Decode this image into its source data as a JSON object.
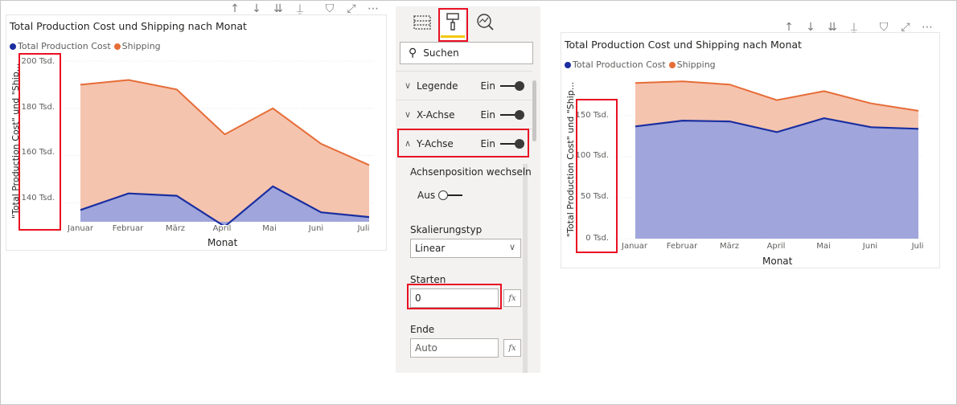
{
  "colors": {
    "blue": "#1a2ea0",
    "blue_fill": "#a0a6db",
    "orange": "#e66c37",
    "orange_fill": "#f5c4ae",
    "highlight": "#e81123",
    "accent": "#f2c811"
  },
  "toolbar_icons": [
    "arrow-up-icon",
    "arrow-down-icon",
    "double-arrow-down-icon",
    "expand-hierarchy-icon",
    "filter-icon",
    "focus-mode-icon",
    "more-options-icon"
  ],
  "left_visual": {
    "title": "Total Production Cost und Shipping nach Monat",
    "legend": [
      "Total Production Cost",
      "Shipping"
    ],
    "y_axis_title": "\"Total Production Cost\" und \"Ship...",
    "x_axis_title": "Monat",
    "y_ticks": [
      "200 Tsd.",
      "180 Tsd.",
      "160 Tsd.",
      "140 Tsd."
    ],
    "x_ticks": [
      "Januar",
      "Februar",
      "März",
      "April",
      "Mai",
      "Juni",
      "Juli"
    ]
  },
  "right_visual": {
    "title": "Total Production Cost und Shipping nach Monat",
    "legend": [
      "Total Production Cost",
      "Shipping"
    ],
    "y_axis_title": "\"Total Production Cost\" und \"Ship...",
    "x_axis_title": "Monat",
    "y_ticks": [
      "150 Tsd.",
      "100 Tsd.",
      "50 Tsd.",
      "0 Tsd."
    ],
    "x_ticks": [
      "Januar",
      "Februar",
      "März",
      "April",
      "Mai",
      "Juni",
      "Juli"
    ]
  },
  "chart_data": [
    {
      "type": "area",
      "title": "Total Production Cost und Shipping nach Monat",
      "categories": [
        "Januar",
        "Februar",
        "März",
        "April",
        "Mai",
        "Juni",
        "Juli"
      ],
      "series": [
        {
          "name": "Total Production Cost",
          "values": [
            137,
            144,
            143,
            130,
            147,
            136,
            134
          ]
        },
        {
          "name": "Shipping",
          "values": [
            190,
            192,
            188,
            169,
            180,
            165,
            156
          ]
        }
      ],
      "xlabel": "Monat",
      "ylabel": "\"Total Production Cost\" und \"Ship...",
      "ylim": [
        132,
        200
      ],
      "grid": true,
      "legend": "top-left"
    },
    {
      "type": "area",
      "title": "Total Production Cost und Shipping nach Monat",
      "categories": [
        "Januar",
        "Februar",
        "März",
        "April",
        "Mai",
        "Juni",
        "Juli"
      ],
      "series": [
        {
          "name": "Total Production Cost",
          "values": [
            137,
            144,
            143,
            130,
            147,
            136,
            134
          ]
        },
        {
          "name": "Shipping",
          "values": [
            190,
            192,
            188,
            169,
            180,
            165,
            156
          ]
        }
      ],
      "xlabel": "Monat",
      "ylabel": "\"Total Production Cost\" und \"Ship...",
      "ylim": [
        0,
        150
      ],
      "grid": true,
      "legend": "top-left"
    }
  ],
  "pane": {
    "search_label": "Suchen",
    "sections": [
      {
        "name": "Legende",
        "state": "Ein"
      },
      {
        "name": "X-Achse",
        "state": "Ein"
      },
      {
        "name": "Y-Achse",
        "state": "Ein"
      }
    ],
    "axis_switch_label": "Achsenposition wechseln",
    "axis_switch_state": "Aus",
    "scale_label": "Skalierungstyp",
    "scale_value": "Linear",
    "start_label": "Starten",
    "start_value": "0",
    "end_label": "Ende",
    "end_placeholder": "Auto",
    "fx_label": "fx"
  }
}
